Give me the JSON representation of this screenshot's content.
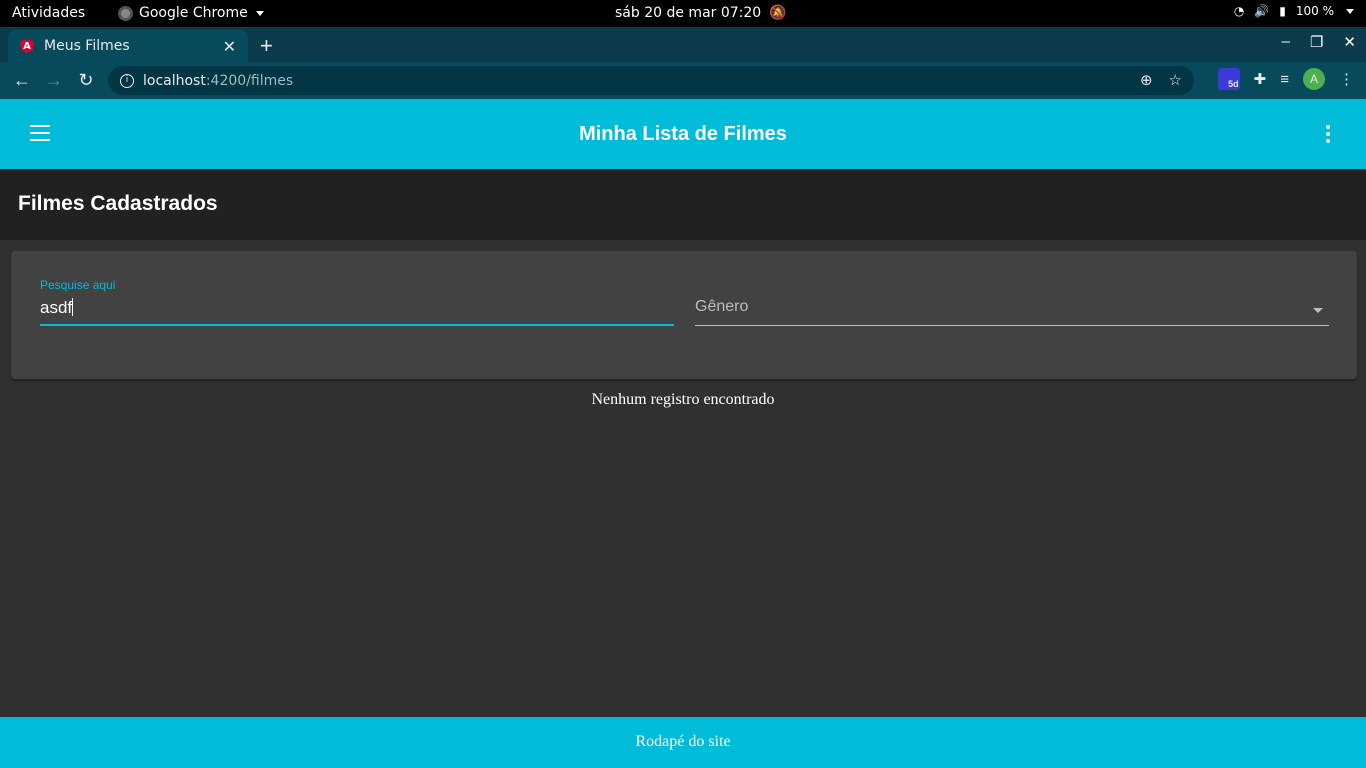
{
  "os": {
    "activities": "Atividades",
    "app_name": "Google Chrome",
    "clock": "sáb 20 de mar  07:20",
    "battery": "100 %"
  },
  "browser": {
    "tab_title": "Meus Filmes",
    "url_host": "localhost",
    "url_path": ":4200/filmes",
    "extension_badge": "5d",
    "profile_initial": "A"
  },
  "app": {
    "title": "Minha Lista de Filmes"
  },
  "page": {
    "title": "Filmes Cadastrados"
  },
  "filters": {
    "search_label": "Pesquise aqui",
    "search_value": "asdf",
    "genre_placeholder": "Gênero"
  },
  "results": {
    "empty_message": "Nenhum registro encontrado"
  },
  "footer": {
    "text": "Rodapé do site"
  },
  "colors": {
    "primary": "#00bcd9",
    "background": "#303030",
    "header": "#212121",
    "card": "#424242"
  }
}
